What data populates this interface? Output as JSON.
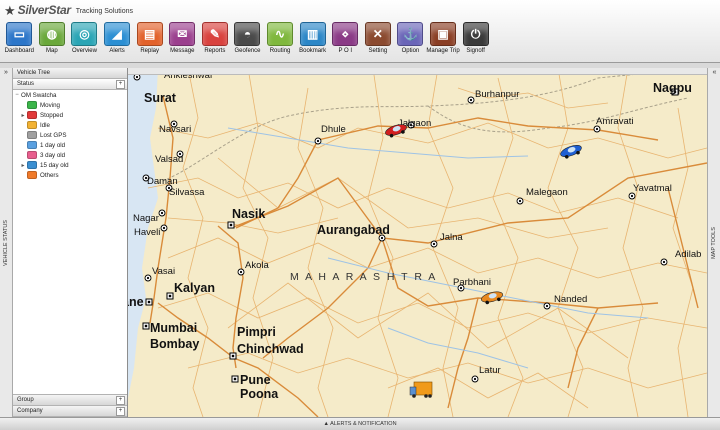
{
  "brand": {
    "name": "SilverStar",
    "subtitle": "Tracking Solutions"
  },
  "toolbar": [
    {
      "key": "dashboard",
      "label": "Dashboard",
      "icon": "monitor-icon",
      "color": "#2c76c9"
    },
    {
      "key": "map",
      "label": "Map",
      "icon": "globe-icon",
      "color": "#6aa83a"
    },
    {
      "key": "overview",
      "label": "Overview",
      "icon": "overview-icon",
      "color": "#2aa5b5"
    },
    {
      "key": "alerts",
      "label": "Alerts",
      "icon": "megaphone-icon",
      "color": "#2b8fd3"
    },
    {
      "key": "replay",
      "label": "Replay",
      "icon": "film-icon",
      "color": "#e2612a"
    },
    {
      "key": "message",
      "label": "Message",
      "icon": "envelope-icon",
      "color": "#9b3f8e"
    },
    {
      "key": "reports",
      "label": "Reports",
      "icon": "clipboard-icon",
      "color": "#d9423e"
    },
    {
      "key": "geofence",
      "label": "Geofence",
      "icon": "geofence-icon",
      "color": "#4a4a4a"
    },
    {
      "key": "routing",
      "label": "Routing",
      "icon": "route-icon",
      "color": "#7fb83d"
    },
    {
      "key": "bookmark",
      "label": "Bookmark",
      "icon": "chart-icon",
      "color": "#2a86c7"
    },
    {
      "key": "poi",
      "label": "P O I",
      "icon": "poi-icon",
      "color": "#8a3a86"
    },
    {
      "key": "setting",
      "label": "Setting",
      "icon": "tools-icon",
      "color": "#8b4a2f"
    },
    {
      "key": "option",
      "label": "Option",
      "icon": "anchor-icon",
      "color": "#6a65b8"
    },
    {
      "key": "manage_trip",
      "label": "Manage Trip",
      "icon": "briefcase-icon",
      "color": "#8a3e24"
    },
    {
      "key": "signoff",
      "label": "Signoff",
      "icon": "signoff-icon",
      "color": "#3a3a3a"
    }
  ],
  "left_strip": {
    "label": "VEHICLE STATUS",
    "collapse": "»"
  },
  "right_strip": {
    "label": "MAP TOOLS",
    "collapse": "«"
  },
  "panel": {
    "title": "Vehicle Tree",
    "status_header": "Status",
    "status_btn": "+",
    "tree_root": "OM Swatcha",
    "statuses": [
      {
        "label": "Moving",
        "color": "#3bb54a",
        "expandable": false
      },
      {
        "label": "Stopped",
        "color": "#e23a3a",
        "expandable": true
      },
      {
        "label": "Idle",
        "color": "#f2b233",
        "expandable": false
      },
      {
        "label": "Lost GPS",
        "color": "#a0a0a0",
        "expandable": false
      },
      {
        "label": "1 day old",
        "color": "#5aa0e0",
        "expandable": false
      },
      {
        "label": "3 day old",
        "color": "#e85f8e",
        "expandable": false
      },
      {
        "label": "15 day old",
        "color": "#3b8fd1",
        "expandable": true
      },
      {
        "label": "Others",
        "color": "#f07a2a",
        "expandable": false
      }
    ],
    "group": {
      "label": "Group",
      "btn": "+"
    },
    "company": {
      "label": "Company",
      "btn": "+"
    }
  },
  "map": {
    "region_label": "M A H A R A S H T R A",
    "cities": [
      {
        "name": "Surat",
        "bold": true
      },
      {
        "name": "Navsari",
        "bold": false
      },
      {
        "name": "Valsad",
        "bold": false
      },
      {
        "name": "Daman",
        "bold": false
      },
      {
        "name": "Silvassa",
        "bold": false
      },
      {
        "name": "Nagar",
        "bold": false
      },
      {
        "name": "Haveli",
        "bold": false
      },
      {
        "name": "Dhule",
        "bold": false
      },
      {
        "name": "Jalgaon",
        "bold": false
      },
      {
        "name": "Burhanpur",
        "bold": false
      },
      {
        "name": "Amravati",
        "bold": false
      },
      {
        "name": "Nagpu",
        "bold": true
      },
      {
        "name": "Yavatmal",
        "bold": false
      },
      {
        "name": "Malegaon",
        "bold": false
      },
      {
        "name": "Nasik",
        "bold": true
      },
      {
        "name": "Aurangabad",
        "bold": true
      },
      {
        "name": "Jalna",
        "bold": false
      },
      {
        "name": "Akola",
        "bold": false
      },
      {
        "name": "Adilab",
        "bold": false
      },
      {
        "name": "Vasai",
        "bold": false
      },
      {
        "name": "Kalyan",
        "bold": true
      },
      {
        "name": "Parbhani",
        "bold": false
      },
      {
        "name": "Nanded",
        "bold": false
      },
      {
        "name": "Mumbai",
        "bold": true
      },
      {
        "name": "Bombay",
        "bold": true
      },
      {
        "name": "Pimpri",
        "bold": true
      },
      {
        "name": "Chinchwad",
        "bold": true
      },
      {
        "name": "Pune",
        "bold": true
      },
      {
        "name": "Poona",
        "bold": true
      },
      {
        "name": "Latur",
        "bold": false
      },
      {
        "name": "Ankleshwar",
        "bold": false
      },
      {
        "name": "ane",
        "bold": true
      }
    ],
    "vehicles": [
      {
        "name": "car-red",
        "icon": "red-car-icon",
        "color": "#d21f1f"
      },
      {
        "name": "car-blue",
        "icon": "blue-car-icon",
        "color": "#1f5fd2"
      },
      {
        "name": "car-orange",
        "icon": "orange-car-icon",
        "color": "#e8891f"
      },
      {
        "name": "truck",
        "icon": "truck-icon",
        "color": "#f09a1a"
      }
    ]
  },
  "bottom": {
    "label": "▲ ALERTS & NOTIFICATION"
  }
}
